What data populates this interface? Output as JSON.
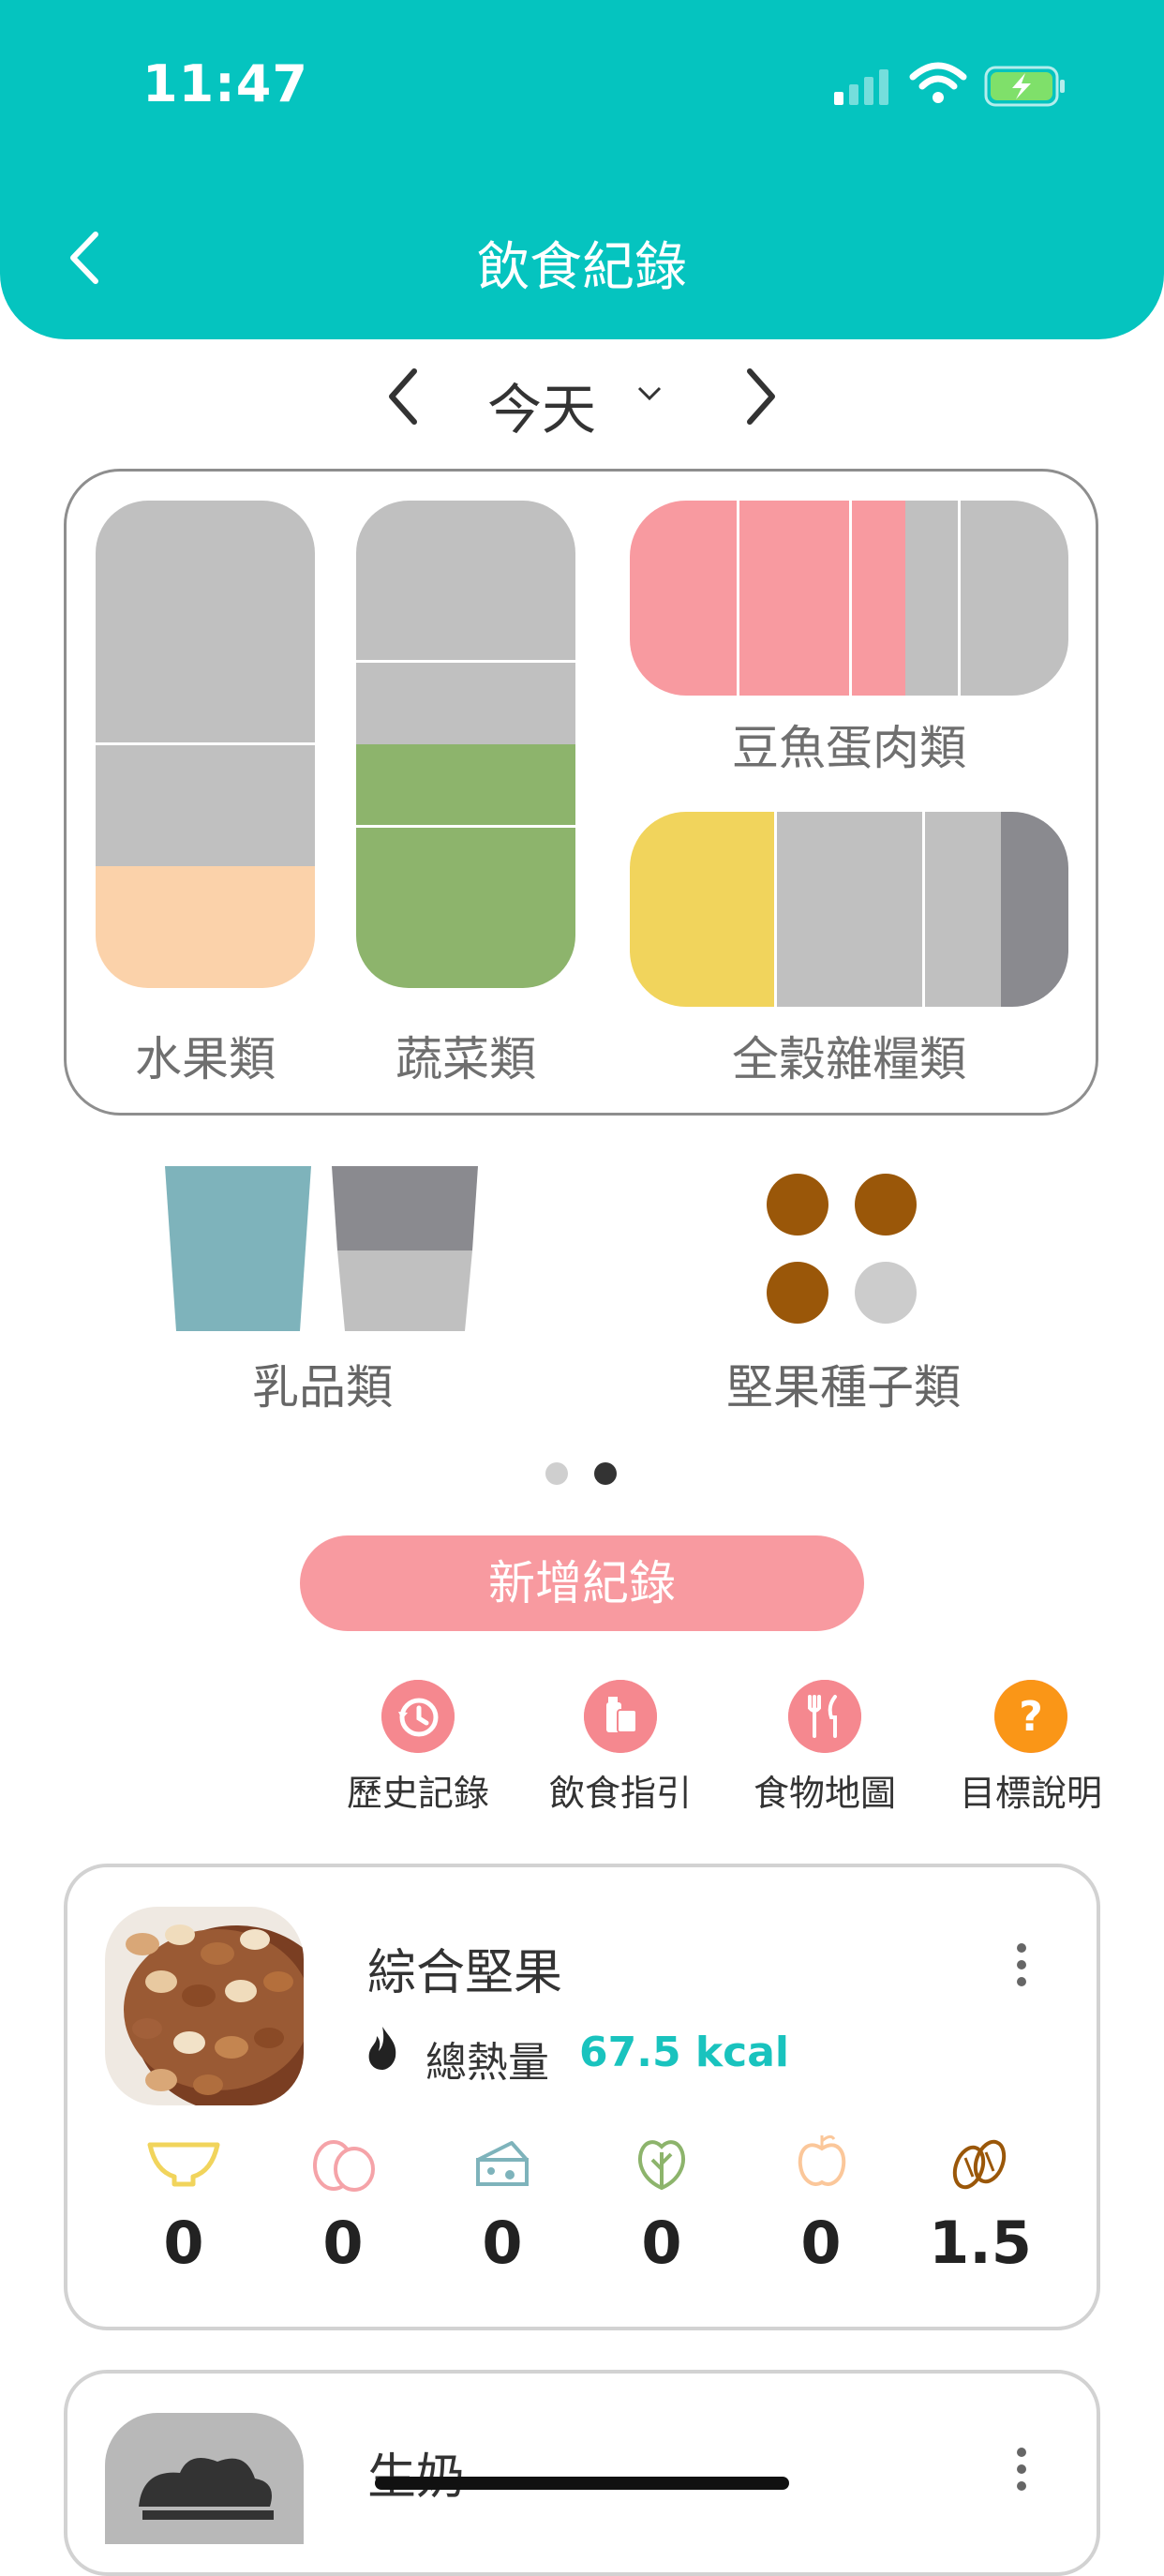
{
  "status": {
    "time": "11:47"
  },
  "header": {
    "title": "飲食紀錄"
  },
  "date_nav": {
    "label": "今天"
  },
  "categories": {
    "fruit": "水果類",
    "vegetable": "蔬菜類",
    "protein": "豆魚蛋肉類",
    "grains": "全穀雜糧類",
    "dairy": "乳品類",
    "nuts": "堅果種子類"
  },
  "pager": {
    "pages": 2,
    "active": 2
  },
  "add_button": {
    "label": "新增紀錄"
  },
  "quick_actions": [
    {
      "label": "歷史記錄",
      "icon": "history-icon"
    },
    {
      "label": "飲食指引",
      "icon": "guide-icon"
    },
    {
      "label": "食物地圖",
      "icon": "food-map-icon"
    },
    {
      "label": "目標說明",
      "icon": "help-icon"
    }
  ],
  "records": [
    {
      "name": "綜合堅果",
      "calorie_label": "總熱量",
      "calorie_value": "67.5 kcal",
      "counts": [
        "0",
        "0",
        "0",
        "0",
        "0",
        "1.5"
      ]
    },
    {
      "name": "生奶"
    }
  ],
  "colors": {
    "header": "#05C4BF",
    "fruit": "#FBD2AA",
    "vegetable": "#8DB46C",
    "protein": "#F89AA0",
    "grains": "#F1D45C",
    "dairy": "#7EB3BB",
    "nuts": "#9A5709",
    "empty": "#C0C0C0",
    "dark_gray": "#8A8A8F"
  }
}
